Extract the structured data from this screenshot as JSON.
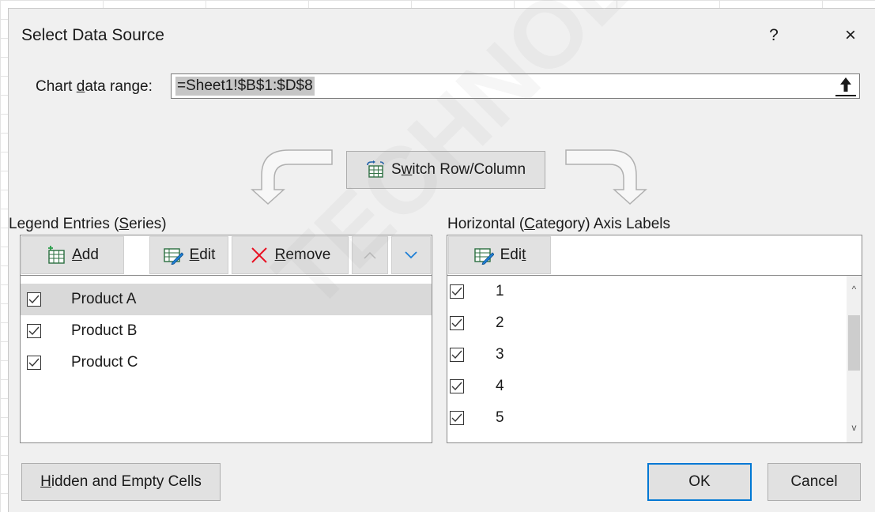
{
  "dialog": {
    "title": "Select Data Source",
    "help_label": "?",
    "close_label": "×"
  },
  "range": {
    "label_pre": "Chart ",
    "label_accel": "d",
    "label_post": "ata range:",
    "value": "=Sheet1!$B$1:$D$8"
  },
  "switch_button": {
    "label_pre": "S",
    "label_accel": "w",
    "label_post": "itch Row/Column"
  },
  "legend": {
    "label_pre": "Legend Entries (",
    "label_accel": "S",
    "label_post": "eries)",
    "add": {
      "accel": "A",
      "rest": "dd"
    },
    "edit": {
      "accel": "E",
      "rest": "dit"
    },
    "remove": {
      "accel": "R",
      "rest": "emove"
    },
    "items": [
      "Product A",
      "Product B",
      "Product C"
    ]
  },
  "axis": {
    "label_pre": "Horizontal (",
    "label_accel": "C",
    "label_post": "ategory) Axis Labels",
    "edit": {
      "pre": "Edi",
      "accel": "t"
    },
    "items": [
      "1",
      "2",
      "3",
      "4",
      "5"
    ]
  },
  "footer": {
    "hidden": {
      "accel": "H",
      "rest": "idden and Empty Cells"
    },
    "ok": "OK",
    "cancel": "Cancel"
  },
  "watermark": "TECHNOLOGY.COM",
  "colors": {
    "accent": "#0078d4",
    "remove_icon": "#e81123",
    "selected_row": "#d9d9d9"
  },
  "icons": [
    "collapse-dialog-icon",
    "switch-row-column-icon",
    "add-table-icon",
    "edit-table-icon",
    "remove-x-icon",
    "chevron-up-icon",
    "chevron-down-icon",
    "checkbox-icon"
  ]
}
